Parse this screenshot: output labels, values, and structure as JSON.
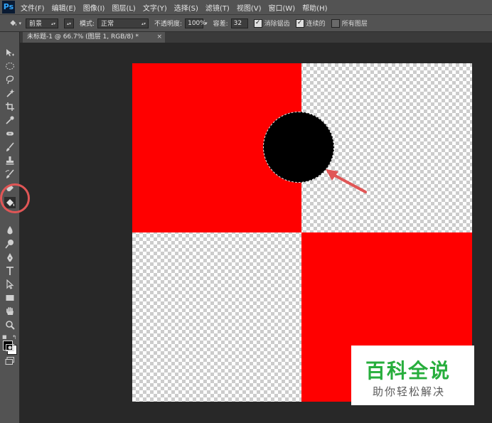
{
  "app": {
    "logo": "Ps"
  },
  "menu": [
    "文件(F)",
    "编辑(E)",
    "图像(I)",
    "图层(L)",
    "文字(Y)",
    "选择(S)",
    "滤镜(T)",
    "视图(V)",
    "窗口(W)",
    "帮助(H)"
  ],
  "options": {
    "source_value": "前景",
    "mode_label": "模式:",
    "mode_value": "正常",
    "opacity_label": "不透明度:",
    "opacity_value": "100%",
    "tolerance_label": "容差:",
    "tolerance_value": "32",
    "antialias_label": "消除锯齿",
    "antialias_checked": true,
    "contiguous_label": "连续的",
    "contiguous_checked": true,
    "all_layers_label": "所有图层",
    "all_layers_checked": false
  },
  "document_tab": {
    "title": "未标题-1 @ 66.7% (图层 1, RGB/8) *",
    "close": "×"
  },
  "tools": [
    "move-icon",
    "marquee-icon",
    "lasso-icon",
    "magic-wand-icon",
    "crop-icon",
    "eyedropper-icon",
    "healing-brush-icon",
    "brush-icon",
    "clone-stamp-icon",
    "history-brush-icon",
    "eraser-icon",
    "paint-bucket-icon",
    "blur-icon",
    "dodge-icon",
    "pen-icon",
    "type-icon",
    "path-selection-icon",
    "rectangle-icon",
    "hand-icon",
    "zoom-icon"
  ],
  "colors": {
    "foreground": "#000000",
    "background": "#ffffff",
    "fill_red": "#ff0000",
    "annotation": "#e05656",
    "watermark_green": "#27ae3c"
  },
  "watermark": {
    "logo": "百科全说",
    "tagline": "助你轻松解决"
  }
}
